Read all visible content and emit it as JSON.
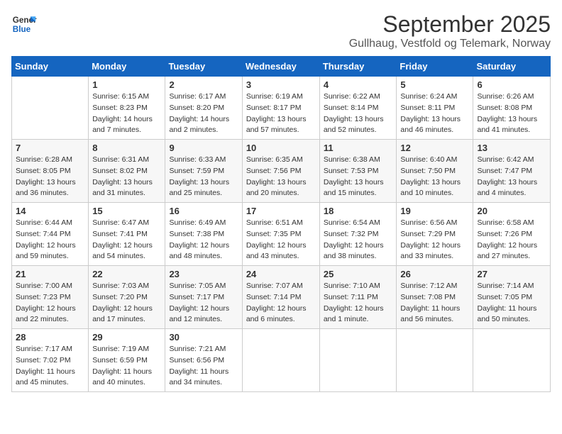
{
  "logo": {
    "line1": "General",
    "line2": "Blue"
  },
  "title": "September 2025",
  "subtitle": "Gullhaug, Vestfold og Telemark, Norway",
  "days_of_week": [
    "Sunday",
    "Monday",
    "Tuesday",
    "Wednesday",
    "Thursday",
    "Friday",
    "Saturday"
  ],
  "weeks": [
    [
      {
        "day": "",
        "sunrise": "",
        "sunset": "",
        "daylight": ""
      },
      {
        "day": "1",
        "sunrise": "Sunrise: 6:15 AM",
        "sunset": "Sunset: 8:23 PM",
        "daylight": "Daylight: 14 hours and 7 minutes."
      },
      {
        "day": "2",
        "sunrise": "Sunrise: 6:17 AM",
        "sunset": "Sunset: 8:20 PM",
        "daylight": "Daylight: 14 hours and 2 minutes."
      },
      {
        "day": "3",
        "sunrise": "Sunrise: 6:19 AM",
        "sunset": "Sunset: 8:17 PM",
        "daylight": "Daylight: 13 hours and 57 minutes."
      },
      {
        "day": "4",
        "sunrise": "Sunrise: 6:22 AM",
        "sunset": "Sunset: 8:14 PM",
        "daylight": "Daylight: 13 hours and 52 minutes."
      },
      {
        "day": "5",
        "sunrise": "Sunrise: 6:24 AM",
        "sunset": "Sunset: 8:11 PM",
        "daylight": "Daylight: 13 hours and 46 minutes."
      },
      {
        "day": "6",
        "sunrise": "Sunrise: 6:26 AM",
        "sunset": "Sunset: 8:08 PM",
        "daylight": "Daylight: 13 hours and 41 minutes."
      }
    ],
    [
      {
        "day": "7",
        "sunrise": "Sunrise: 6:28 AM",
        "sunset": "Sunset: 8:05 PM",
        "daylight": "Daylight: 13 hours and 36 minutes."
      },
      {
        "day": "8",
        "sunrise": "Sunrise: 6:31 AM",
        "sunset": "Sunset: 8:02 PM",
        "daylight": "Daylight: 13 hours and 31 minutes."
      },
      {
        "day": "9",
        "sunrise": "Sunrise: 6:33 AM",
        "sunset": "Sunset: 7:59 PM",
        "daylight": "Daylight: 13 hours and 25 minutes."
      },
      {
        "day": "10",
        "sunrise": "Sunrise: 6:35 AM",
        "sunset": "Sunset: 7:56 PM",
        "daylight": "Daylight: 13 hours and 20 minutes."
      },
      {
        "day": "11",
        "sunrise": "Sunrise: 6:38 AM",
        "sunset": "Sunset: 7:53 PM",
        "daylight": "Daylight: 13 hours and 15 minutes."
      },
      {
        "day": "12",
        "sunrise": "Sunrise: 6:40 AM",
        "sunset": "Sunset: 7:50 PM",
        "daylight": "Daylight: 13 hours and 10 minutes."
      },
      {
        "day": "13",
        "sunrise": "Sunrise: 6:42 AM",
        "sunset": "Sunset: 7:47 PM",
        "daylight": "Daylight: 13 hours and 4 minutes."
      }
    ],
    [
      {
        "day": "14",
        "sunrise": "Sunrise: 6:44 AM",
        "sunset": "Sunset: 7:44 PM",
        "daylight": "Daylight: 12 hours and 59 minutes."
      },
      {
        "day": "15",
        "sunrise": "Sunrise: 6:47 AM",
        "sunset": "Sunset: 7:41 PM",
        "daylight": "Daylight: 12 hours and 54 minutes."
      },
      {
        "day": "16",
        "sunrise": "Sunrise: 6:49 AM",
        "sunset": "Sunset: 7:38 PM",
        "daylight": "Daylight: 12 hours and 48 minutes."
      },
      {
        "day": "17",
        "sunrise": "Sunrise: 6:51 AM",
        "sunset": "Sunset: 7:35 PM",
        "daylight": "Daylight: 12 hours and 43 minutes."
      },
      {
        "day": "18",
        "sunrise": "Sunrise: 6:54 AM",
        "sunset": "Sunset: 7:32 PM",
        "daylight": "Daylight: 12 hours and 38 minutes."
      },
      {
        "day": "19",
        "sunrise": "Sunrise: 6:56 AM",
        "sunset": "Sunset: 7:29 PM",
        "daylight": "Daylight: 12 hours and 33 minutes."
      },
      {
        "day": "20",
        "sunrise": "Sunrise: 6:58 AM",
        "sunset": "Sunset: 7:26 PM",
        "daylight": "Daylight: 12 hours and 27 minutes."
      }
    ],
    [
      {
        "day": "21",
        "sunrise": "Sunrise: 7:00 AM",
        "sunset": "Sunset: 7:23 PM",
        "daylight": "Daylight: 12 hours and 22 minutes."
      },
      {
        "day": "22",
        "sunrise": "Sunrise: 7:03 AM",
        "sunset": "Sunset: 7:20 PM",
        "daylight": "Daylight: 12 hours and 17 minutes."
      },
      {
        "day": "23",
        "sunrise": "Sunrise: 7:05 AM",
        "sunset": "Sunset: 7:17 PM",
        "daylight": "Daylight: 12 hours and 12 minutes."
      },
      {
        "day": "24",
        "sunrise": "Sunrise: 7:07 AM",
        "sunset": "Sunset: 7:14 PM",
        "daylight": "Daylight: 12 hours and 6 minutes."
      },
      {
        "day": "25",
        "sunrise": "Sunrise: 7:10 AM",
        "sunset": "Sunset: 7:11 PM",
        "daylight": "Daylight: 12 hours and 1 minute."
      },
      {
        "day": "26",
        "sunrise": "Sunrise: 7:12 AM",
        "sunset": "Sunset: 7:08 PM",
        "daylight": "Daylight: 11 hours and 56 minutes."
      },
      {
        "day": "27",
        "sunrise": "Sunrise: 7:14 AM",
        "sunset": "Sunset: 7:05 PM",
        "daylight": "Daylight: 11 hours and 50 minutes."
      }
    ],
    [
      {
        "day": "28",
        "sunrise": "Sunrise: 7:17 AM",
        "sunset": "Sunset: 7:02 PM",
        "daylight": "Daylight: 11 hours and 45 minutes."
      },
      {
        "day": "29",
        "sunrise": "Sunrise: 7:19 AM",
        "sunset": "Sunset: 6:59 PM",
        "daylight": "Daylight: 11 hours and 40 minutes."
      },
      {
        "day": "30",
        "sunrise": "Sunrise: 7:21 AM",
        "sunset": "Sunset: 6:56 PM",
        "daylight": "Daylight: 11 hours and 34 minutes."
      },
      {
        "day": "",
        "sunrise": "",
        "sunset": "",
        "daylight": ""
      },
      {
        "day": "",
        "sunrise": "",
        "sunset": "",
        "daylight": ""
      },
      {
        "day": "",
        "sunrise": "",
        "sunset": "",
        "daylight": ""
      },
      {
        "day": "",
        "sunrise": "",
        "sunset": "",
        "daylight": ""
      }
    ]
  ]
}
